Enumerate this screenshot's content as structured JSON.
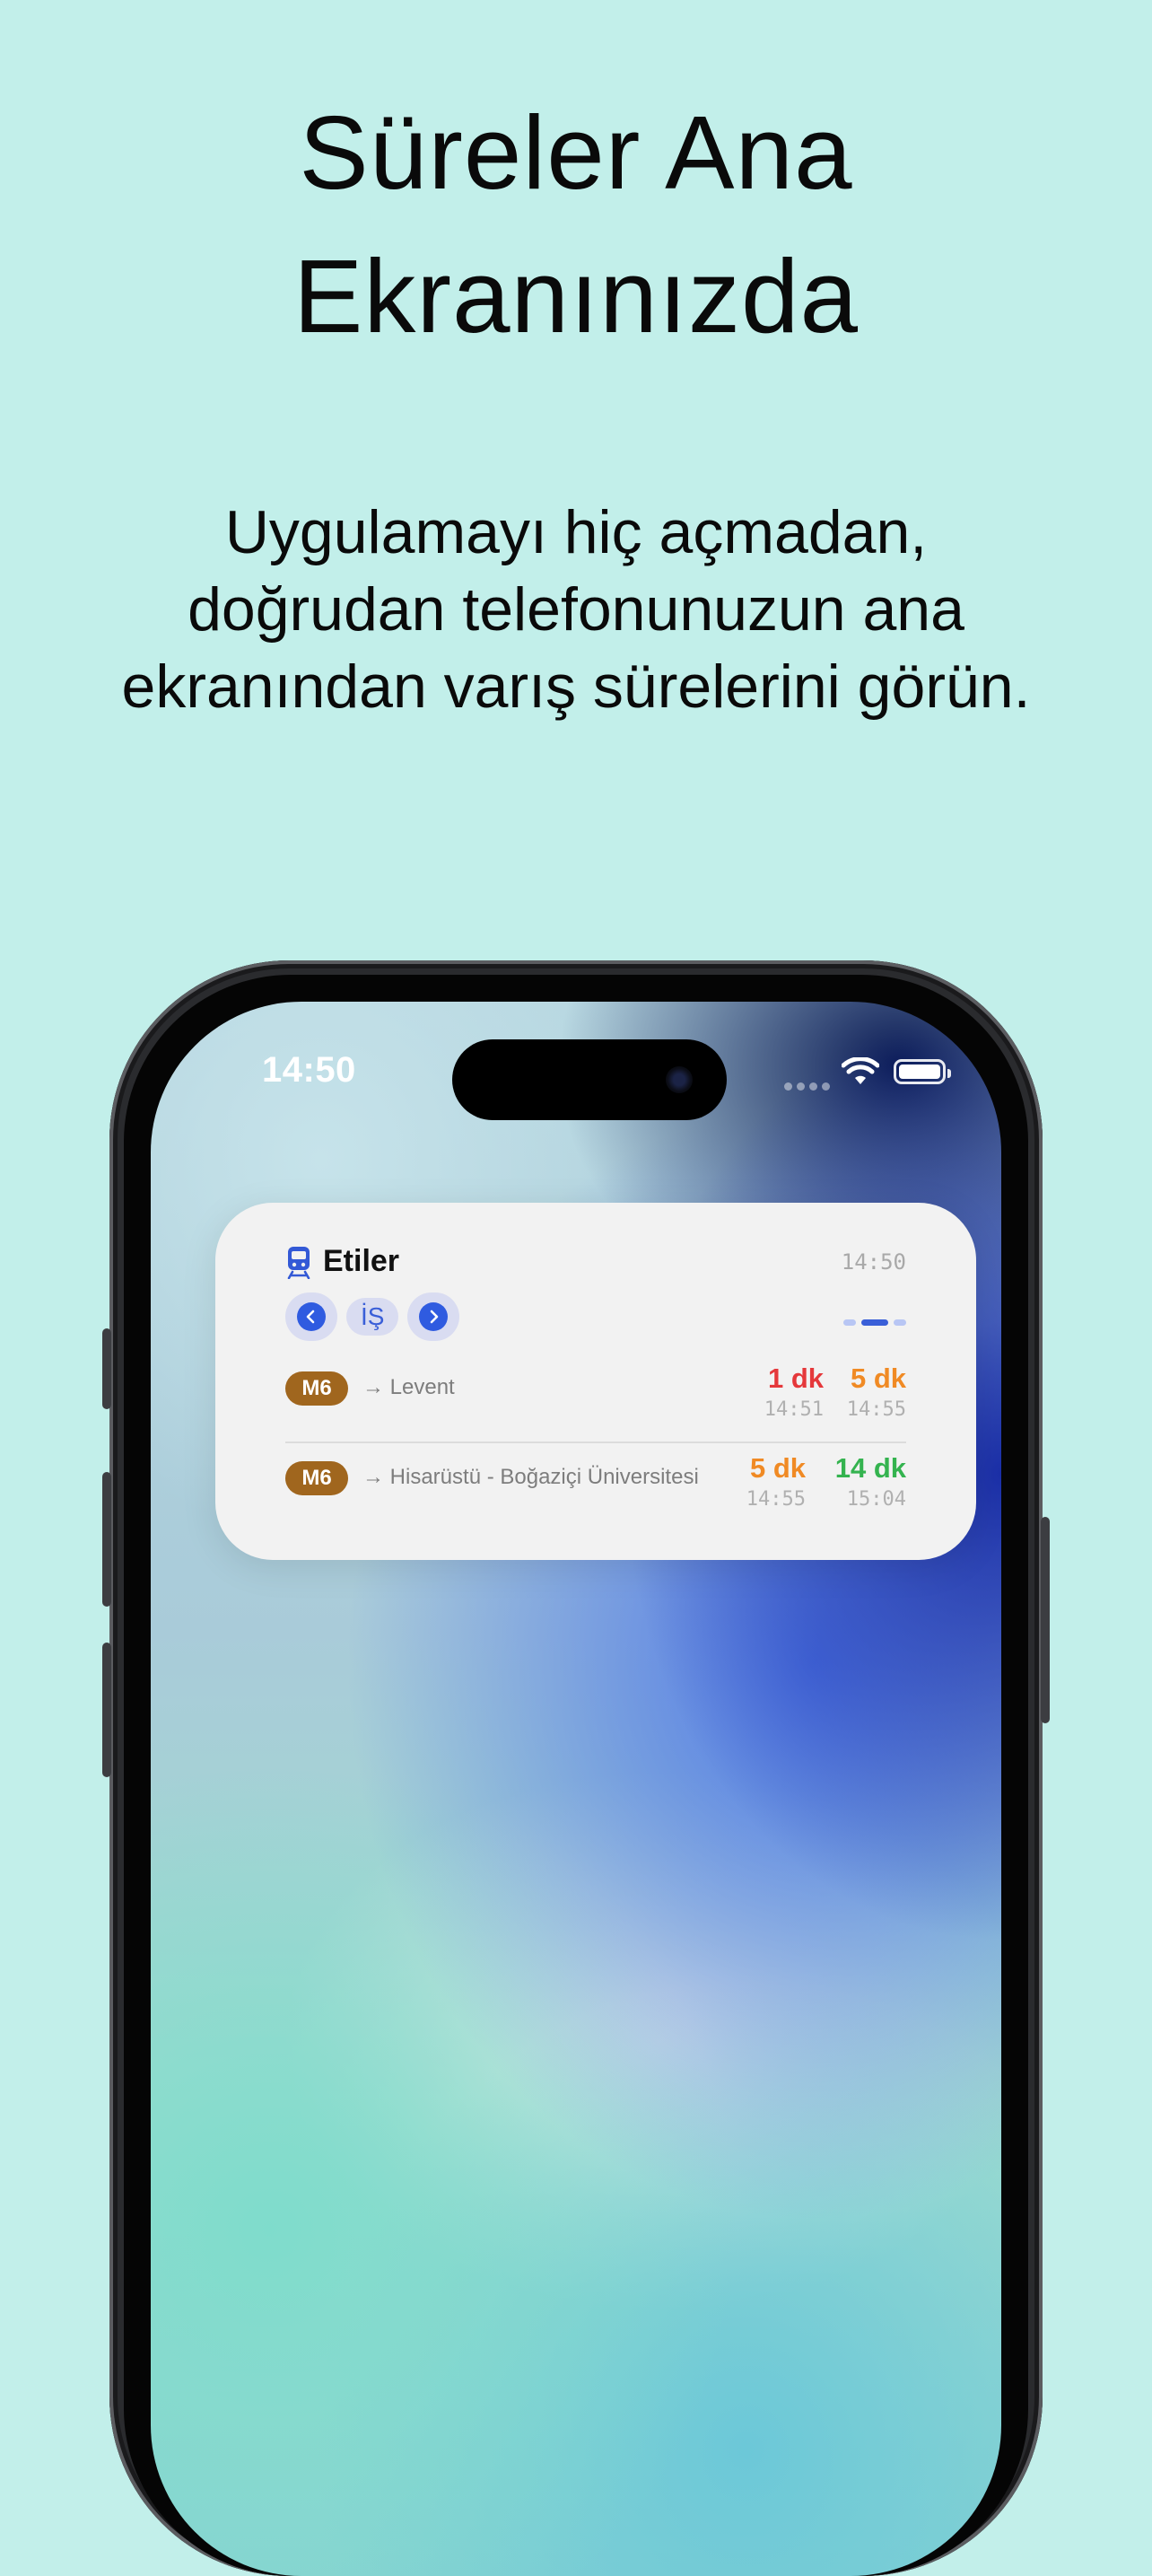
{
  "headline": {
    "line1": "Süreler Ana",
    "line2": "Ekranınızda"
  },
  "subheadline": "Uygulamayı hiç açmadan, doğrudan telefonunuzun ana ekranından varış sürelerini görün.",
  "phone": {
    "status_bar": {
      "time": "14:50"
    },
    "widget": {
      "icon": "train-icon",
      "stop_name": "Etiler",
      "updated_time": "14:50",
      "group_label": "İŞ",
      "pages": {
        "count": 3,
        "active": 2
      },
      "rows": [
        {
          "line": "M6",
          "destination": "→ Levent",
          "arrivals": [
            {
              "minutes": "1 dk",
              "time": "14:51",
              "color": "#e5383b"
            },
            {
              "minutes": "5 dk",
              "time": "14:55",
              "color": "#f08a24"
            }
          ]
        },
        {
          "line": "M6",
          "destination": "→ Hisarüstü - Boğaziçi Üniversitesi",
          "arrivals": [
            {
              "minutes": "5 dk",
              "time": "14:55",
              "color": "#f08a24"
            },
            {
              "minutes": "14 dk",
              "time": "15:04",
              "color": "#34b34f"
            }
          ]
        }
      ],
      "colors": {
        "line_badge": "#a0661e",
        "accent": "#2f5be0"
      }
    }
  },
  "background_color": "#c2efea"
}
